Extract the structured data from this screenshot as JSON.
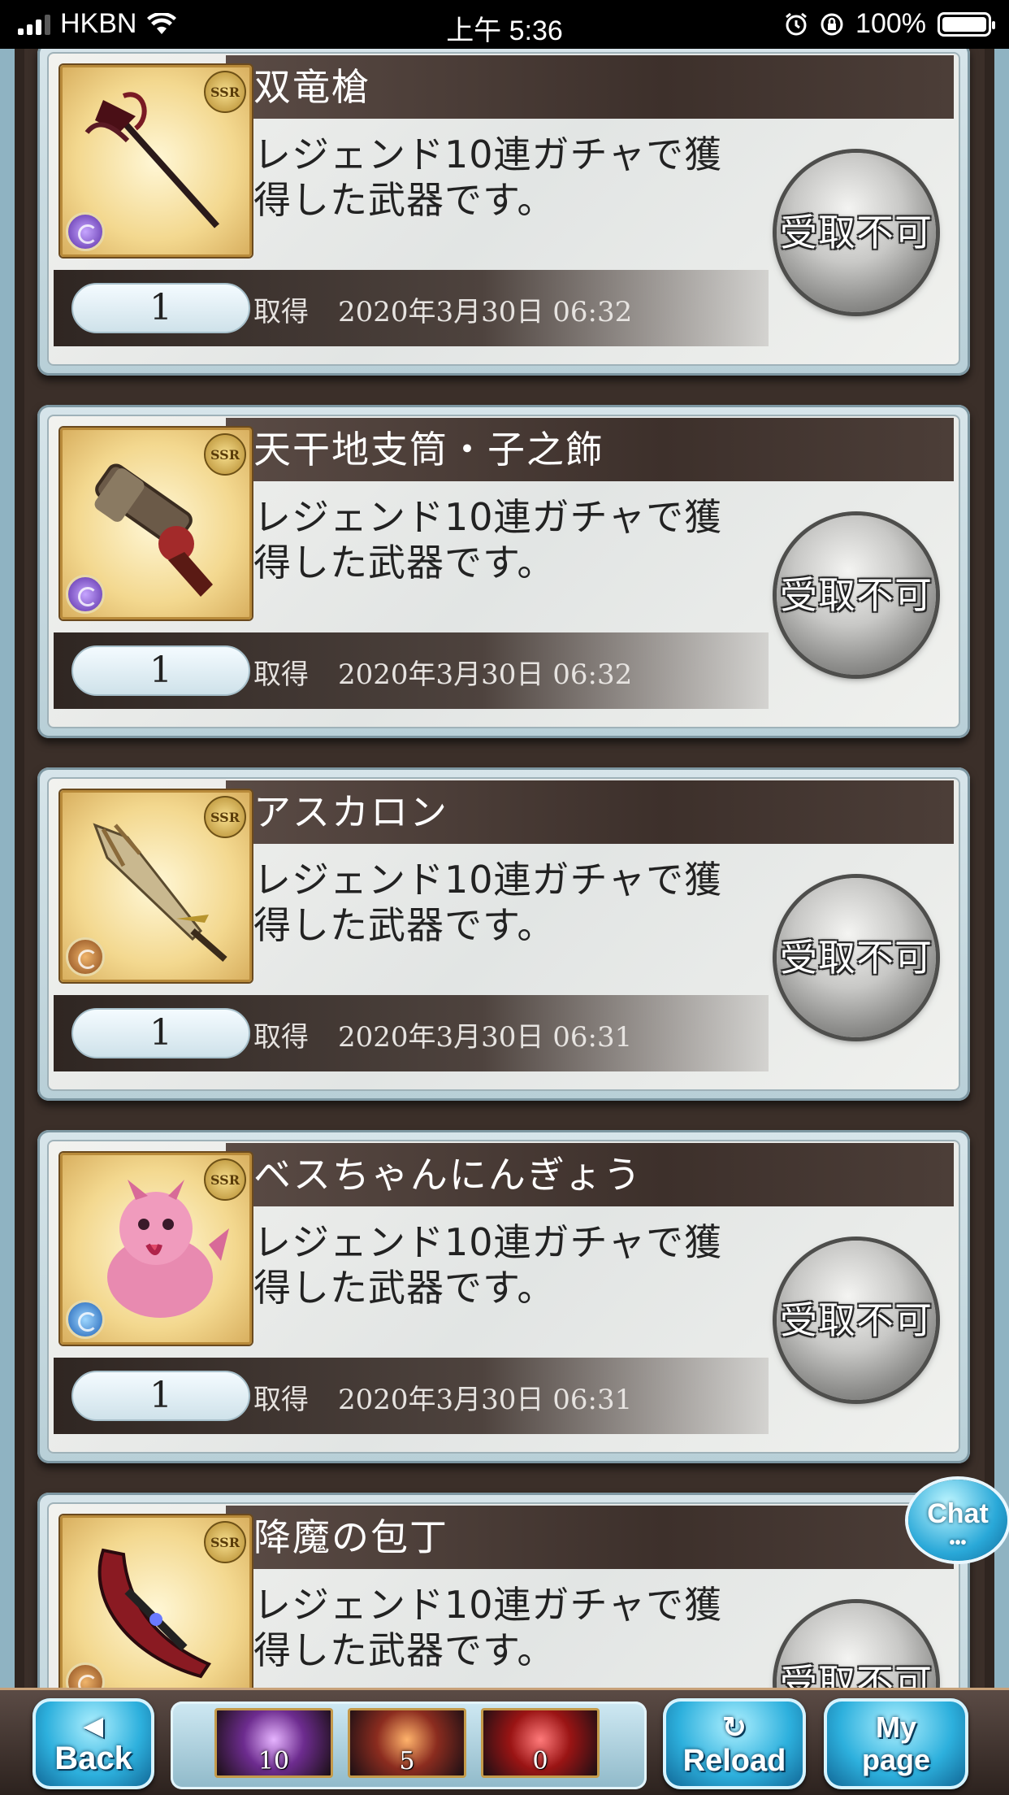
{
  "status_bar": {
    "carrier": "HKBN",
    "time": "上午 5:36",
    "battery": "100%"
  },
  "items": [
    {
      "name": "双竜槍",
      "rarity": "SSR",
      "element": "dark",
      "description": "レジェンド10連ガチャで獲得した武器です。",
      "quantity": "1",
      "acquired_label": "取得",
      "acquired_date": "2020年3月30日 06:32",
      "button_label": "受取不可"
    },
    {
      "name": "天干地支筒・子之飾",
      "rarity": "SSR",
      "element": "dark",
      "description": "レジェンド10連ガチャで獲得した武器です。",
      "quantity": "1",
      "acquired_label": "取得",
      "acquired_date": "2020年3月30日 06:32",
      "button_label": "受取不可"
    },
    {
      "name": "アスカロン",
      "rarity": "SSR",
      "element": "earth",
      "description": "レジェンド10連ガチャで獲得した武器です。",
      "quantity": "1",
      "acquired_label": "取得",
      "acquired_date": "2020年3月30日 06:31",
      "button_label": "受取不可"
    },
    {
      "name": "ベスちゃんにんぎょう",
      "rarity": "SSR",
      "element": "water",
      "description": "レジェンド10連ガチャで獲得した武器です。",
      "quantity": "1",
      "acquired_label": "取得",
      "acquired_date": "2020年3月30日 06:31",
      "button_label": "受取不可"
    },
    {
      "name": "降魔の包丁",
      "rarity": "SSR",
      "element": "earth",
      "description": "レジェンド10連ガチャで獲得した武器です。",
      "quantity": "",
      "acquired_label": "",
      "acquired_date": "",
      "button_label": "受取不可"
    }
  ],
  "chat": {
    "label": "Chat",
    "dots": "•••"
  },
  "bottom_nav": {
    "back": {
      "arrow": "◀",
      "label": "Back"
    },
    "tickets": [
      {
        "count": "10",
        "color": "purple"
      },
      {
        "count": "5",
        "color": "orange"
      },
      {
        "count": "0",
        "color": "red"
      }
    ],
    "reload": {
      "symbol": "↻",
      "label": "Reload"
    },
    "mypage": {
      "label_line1": "My",
      "label_line2": "page"
    }
  }
}
